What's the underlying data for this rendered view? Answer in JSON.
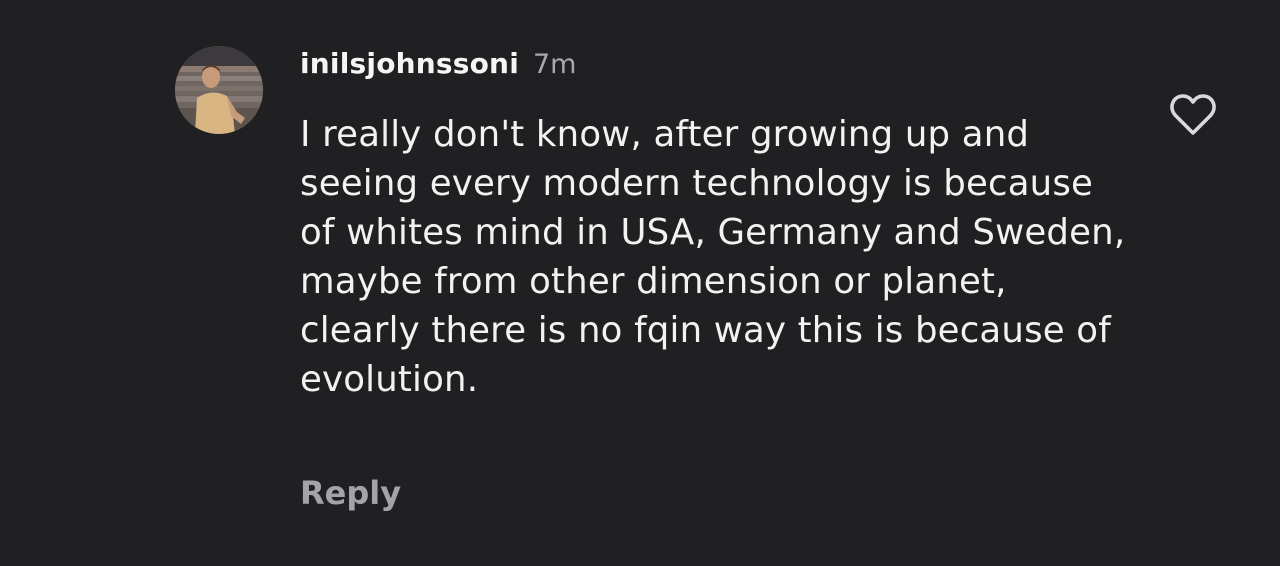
{
  "comment": {
    "username": "inilsjohnssoni",
    "timestamp": "7m",
    "text": "I really don't know, after growing up and seeing every modern technology is because of whites mind in USA, Germany and Sweden, maybe from other dimension or planet, clearly there is no fqin way this is because of evolution.",
    "reply_label": "Reply",
    "avatar_icon": "user-avatar-photo",
    "like_icon": "heart-outline-icon"
  },
  "colors": {
    "background": "#202023",
    "text_primary": "#f2f2f2",
    "text_secondary": "#a8a8ad"
  }
}
